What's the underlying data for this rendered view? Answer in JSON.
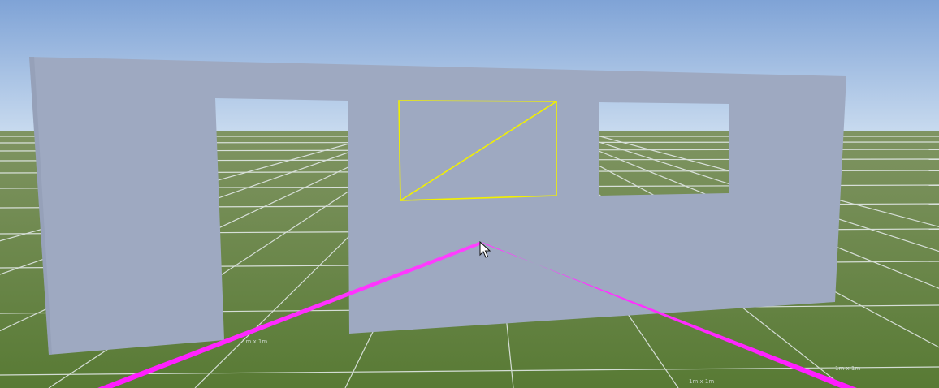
{
  "scene": {
    "sky_top_color": "#7fa3d6",
    "sky_horizon_color": "#c9dbef",
    "ground_near_color": "#5c7a3a",
    "ground_far_color": "#7a8f5b",
    "grid_line_color": "#e9eef0",
    "wall_color": "#9ea9c1",
    "wall_shadow_color": "#b8c0d2",
    "selection_outline_color": "#f2f000",
    "laser_color": "#ff2bff"
  },
  "grid_labels": [
    {
      "text": "1m x 1m"
    },
    {
      "text": "1m x 1m"
    },
    {
      "text": "1m x 1m"
    }
  ],
  "cursor": {
    "icon": "arrow-cursor-icon"
  }
}
